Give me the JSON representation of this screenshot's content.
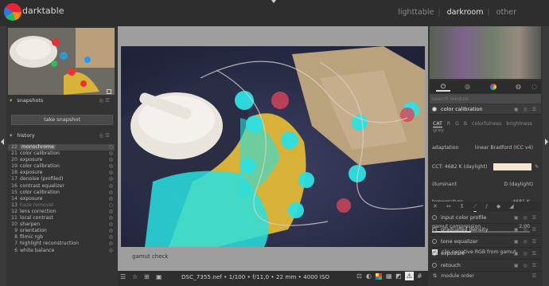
{
  "app_title": "darktable",
  "views": [
    "lighttable",
    "darkroom",
    "other"
  ],
  "views_active": "darkroom",
  "left": {
    "snapshots_label": "snapshots",
    "take_snapshot_label": "take snapshot",
    "history_label": "history",
    "history_items": [
      {
        "num": "22",
        "label": "monochrome",
        "state": "off",
        "selected": true
      },
      {
        "num": "21",
        "label": "color calibration",
        "state": "on"
      },
      {
        "num": "20",
        "label": "exposure",
        "state": "on"
      },
      {
        "num": "19",
        "label": "color calibration",
        "state": "on"
      },
      {
        "num": "18",
        "label": "exposure",
        "state": "on"
      },
      {
        "num": "17",
        "label": "denoise (profiled)",
        "state": "on"
      },
      {
        "num": "16",
        "label": "contrast equalizer",
        "state": "on"
      },
      {
        "num": "15",
        "label": "color calibration",
        "state": "on"
      },
      {
        "num": "14",
        "label": "exposure",
        "state": "on"
      },
      {
        "num": "13",
        "label": "haze removal",
        "state": "off",
        "disabled": true
      },
      {
        "num": "12",
        "label": "lens correction",
        "state": "on"
      },
      {
        "num": "11",
        "label": "local contrast",
        "state": "on"
      },
      {
        "num": "10",
        "label": "sharpen",
        "state": "on"
      },
      {
        "num": "9",
        "label": "orientation",
        "state": "on"
      },
      {
        "num": "8",
        "label": "filmic rgb",
        "state": "on"
      },
      {
        "num": "7",
        "label": "highlight reconstruction",
        "state": "on"
      },
      {
        "num": "6",
        "label": "white balance",
        "state": "on"
      }
    ]
  },
  "center": {
    "gamut_label": "gamut check",
    "image_info": "DSC_7355.nef • 1/100 • f/11,0 • 22 mm • 4000 ISO"
  },
  "right": {
    "search_placeholder": "search module",
    "module_title": "color calibration",
    "tabs": [
      "CAT",
      "R",
      "G",
      "B",
      "colorfulness",
      "brightness",
      "grey"
    ],
    "tab_active": "CAT",
    "adaptation_label": "adaptation",
    "adaptation_value": "linear Bradford (ICC v4)",
    "cct_label": "CCT: 4682 K (daylight)",
    "illuminant_label": "illuminant",
    "illuminant_value": "D (daylight)",
    "temperature_label": "temperature",
    "temperature_value": "4681 K",
    "temperature_level": 0.42,
    "gamut_compression_label": "gamut compression",
    "gamut_compression_value": "2,00",
    "gamut_compression_level": 0.4,
    "clip_label": "clip negative RGB from gamut",
    "modules": [
      "input color profile",
      "graduated density",
      "tone equalizer",
      "exposure",
      "retouch"
    ],
    "module_order_label": "module order"
  },
  "colors": {
    "accent": "#ffffff",
    "gamut": "#2ee0e0",
    "glove": "#d8b238"
  }
}
